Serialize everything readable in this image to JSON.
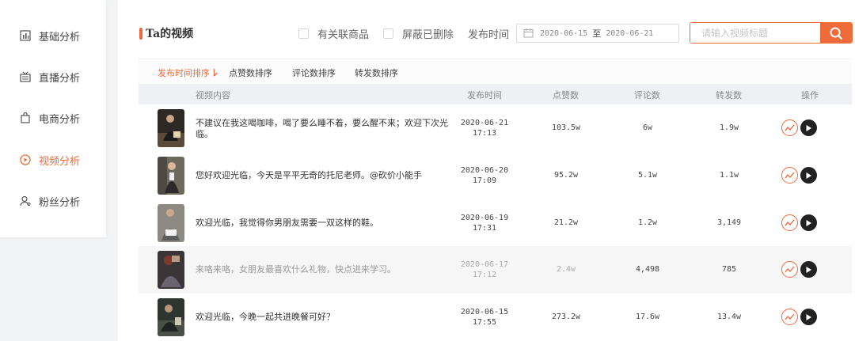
{
  "sidebar": {
    "items": [
      {
        "label": "基础分析",
        "icon": "bar-chart-icon",
        "active": false
      },
      {
        "label": "直播分析",
        "icon": "tv-icon",
        "active": false
      },
      {
        "label": "电商分析",
        "icon": "shopping-bag-icon",
        "active": false
      },
      {
        "label": "视频分析",
        "icon": "play-circle-icon",
        "active": true
      },
      {
        "label": "粉丝分析",
        "icon": "user-icon",
        "active": false
      }
    ]
  },
  "header": {
    "title": "Ta的视频",
    "filter_related": "有关联商品",
    "filter_hide_deleted": "屏蔽已删除",
    "publish_time_label": "发布时间",
    "date_start": "2020-06-15",
    "date_sep": "至",
    "date_end": "2020-06-21",
    "search_placeholder": "请输入视频标题"
  },
  "sort_tabs": [
    {
      "label": "发布时间排序",
      "active": true
    },
    {
      "label": "点赞数排序",
      "active": false
    },
    {
      "label": "评论数排序",
      "active": false
    },
    {
      "label": "转发数排序",
      "active": false
    }
  ],
  "table": {
    "columns": [
      "视频内容",
      "发布时间",
      "点赞数",
      "评论数",
      "转发数",
      "操作"
    ],
    "rows": [
      {
        "title": "不建议在我这喝咖啡，喝了要么睡不着，要么醒不来；欢迎下次光临。",
        "date": "2020-06-21",
        "time": "17:13",
        "likes": "103.5w",
        "comments": "6w",
        "shares": "1.9w",
        "dim": false
      },
      {
        "title": "您好欢迎光临，今天是平平无奇的托尼老师。@砍价小能手",
        "date": "2020-06-20",
        "time": "17:09",
        "likes": "95.2w",
        "comments": "5.1w",
        "shares": "1.1w",
        "dim": false
      },
      {
        "title": "欢迎光临，我觉得你男朋友需要一双这样的鞋。",
        "date": "2020-06-19",
        "time": "17:31",
        "likes": "21.2w",
        "comments": "1.2w",
        "shares": "3,149",
        "dim": false
      },
      {
        "title": "来咯来咯，女朋友最喜欢什么礼物，快点进来学习。",
        "date": "2020-06-17",
        "time": "17:12",
        "likes": "2.4w",
        "comments": "4,498",
        "shares": "785",
        "dim": true
      },
      {
        "title": "欢迎光临，今晚一起共进晚餐可好？",
        "date": "2020-06-15",
        "time": "17:55",
        "likes": "273.2w",
        "comments": "17.6w",
        "shares": "13.4w",
        "dim": false
      }
    ]
  },
  "colors": {
    "accent": "#ef6b3a",
    "play_button": "#222222"
  }
}
